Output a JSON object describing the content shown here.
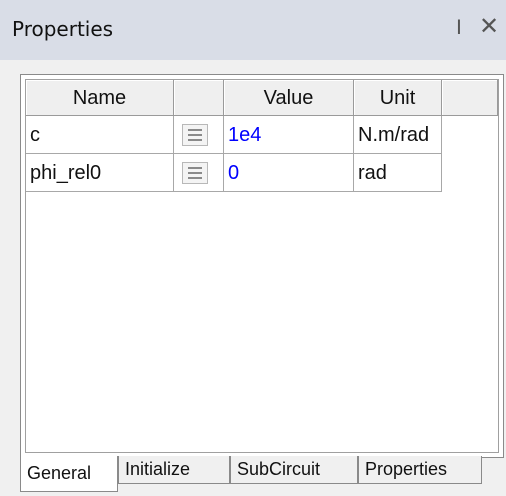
{
  "panel": {
    "title": "Properties",
    "pin_icon": "pin-icon",
    "close_icon": "close-icon"
  },
  "grid": {
    "columns": [
      "Name",
      "",
      "Value",
      "Unit",
      ""
    ],
    "rows": [
      {
        "name": "c",
        "value": "1e4",
        "unit": "N.m/rad"
      },
      {
        "name": "phi_rel0",
        "value": "0",
        "unit": "rad"
      }
    ],
    "value_color": "#0000ff"
  },
  "tabs": [
    {
      "label": "General",
      "active": true
    },
    {
      "label": "Initialize",
      "active": false
    },
    {
      "label": "SubCircuit",
      "active": false
    },
    {
      "label": "Properties",
      "active": false
    }
  ]
}
